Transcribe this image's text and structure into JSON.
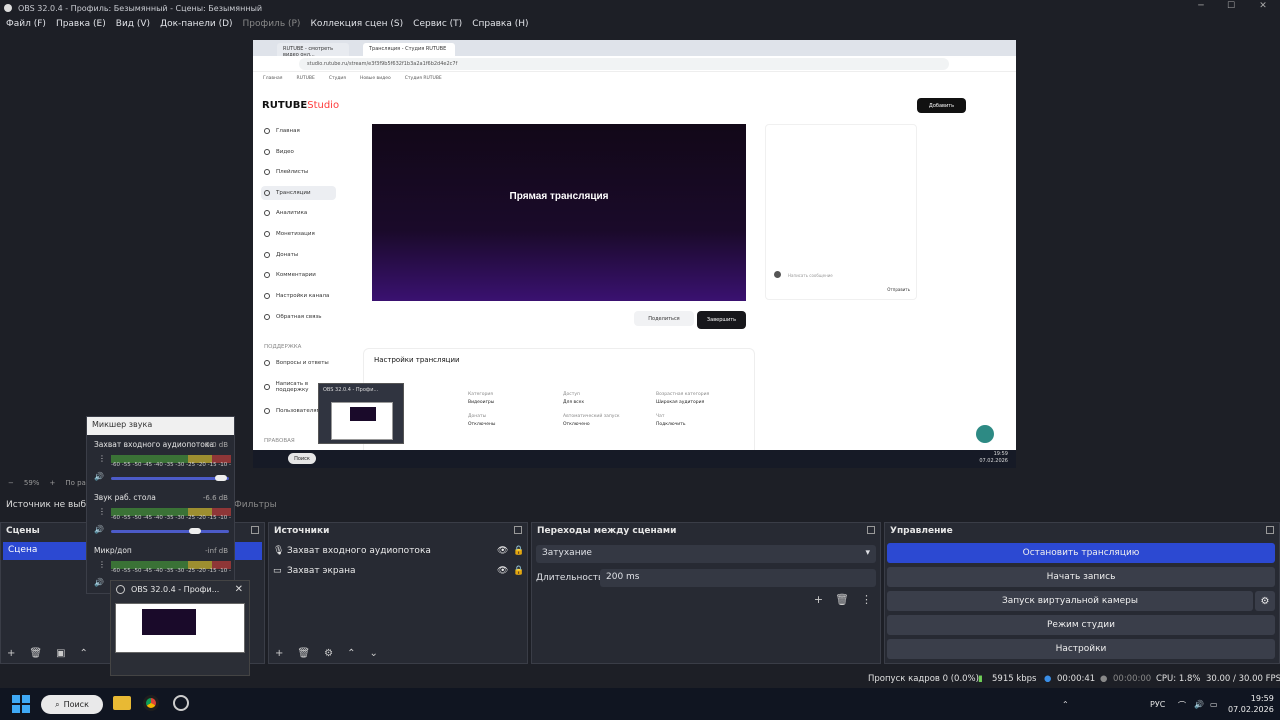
{
  "window": {
    "title": "OBS 32.0.4 - Профиль: Безымянный - Сцены: Безымянный"
  },
  "menu": [
    "Файл (F)",
    "Правка (E)",
    "Вид (V)",
    "Док-панели (D)",
    "Профиль (P)",
    "Коллекция сцен (S)",
    "Сервис (T)",
    "Справка (H)"
  ],
  "preview": {
    "tabs": [
      "RUTUBE - смотреть видео онл...",
      "Трансляция - Студия RUTUBE"
    ],
    "address": "studio.rutube.ru/stream/e3f3f9b5f632f1b3a2a1f6b2d4e2c7f",
    "bookmarks": [
      "Главная",
      "RUTUBE",
      "Студия",
      "Новые видео",
      "Студия RUTUBE"
    ],
    "logo_main": "RUTUBE",
    "logo_sub": "Studio",
    "add_button": "Добавить",
    "sidebar": [
      "Главная",
      "Видео",
      "Плейлисты",
      "Трансляции",
      "Аналитика",
      "Монетизация",
      "Донаты",
      "Комментарии",
      "Настройки канала",
      "Обратная связь"
    ],
    "support_header": "ПОДДЕРЖКА",
    "support_items": [
      "Вопросы и ответы",
      "Написать в поддержку",
      "Пользователям"
    ],
    "section_footer": "ПРАВОВАЯ",
    "player_text": "Прямая трансляция",
    "share_button": "Поделиться",
    "finish_button": "Завершить",
    "chat_placeholder": "Написать сообщение",
    "chat_send": "Отправить",
    "settings_title": "Настройки трансляции",
    "settings_fields": [
      {
        "label": "Категория",
        "value": "Видеоигры"
      },
      {
        "label": "Доступ",
        "value": "Для всех"
      },
      {
        "label": "Возрастная категория",
        "value": "Широкая аудитория"
      },
      {
        "label": "Донаты",
        "value": "Отключены"
      },
      {
        "label": "Автоматический запуск",
        "value": "Отключено"
      },
      {
        "label": "Чат",
        "value": "Подключить"
      }
    ],
    "taskbar_search": "Поиск",
    "taskbar_time": "19:59",
    "taskbar_date": "07.02.2026"
  },
  "mixer": {
    "title": "Микшер звука",
    "channels": [
      {
        "name": "Захват входного аудиопотока",
        "db": "0.0 dB",
        "level": 0.98
      },
      {
        "name": "Звук раб. стола",
        "db": "-6.6 dB",
        "level": 0.74
      },
      {
        "name": "Микр/доп",
        "db": "-inf dB",
        "level": 0.0
      }
    ],
    "ticks": "-60 -55 -50 -45 -40 -35 -30 -25 -20 -15 -10 -5 0"
  },
  "thumbnail_small_title": "OBS 32.0.4 - Профи...",
  "thumbnail_popup": {
    "title": "OBS 32.0.4 - Профи..."
  },
  "zoom": {
    "value": "59%",
    "label": "По раз"
  },
  "source_status": "Источник не выбр",
  "filters_tab": "Фильтры",
  "scenes": {
    "title": "Сцены",
    "items": [
      "Сцена"
    ]
  },
  "sources": {
    "title": "Источники",
    "items": [
      {
        "name": "Захват входного аудиопотока",
        "type": "audio"
      },
      {
        "name": "Захват экрана",
        "type": "display"
      }
    ]
  },
  "transitions": {
    "title": "Переходы между сценами",
    "selected": "Затухание",
    "duration_label": "Длительность",
    "duration_value": "200 ms"
  },
  "controls": {
    "title": "Управление",
    "buttons": [
      "Остановить трансляцию",
      "Начать запись",
      "Запуск виртуальной камеры",
      "Режим студии",
      "Настройки"
    ]
  },
  "status": {
    "dropped": "Пропуск кадров 0 (0.0%)",
    "bitrate": "5915 kbps",
    "stream_time": "00:00:41",
    "rec_time": "00:00:00",
    "cpu": "CPU: 1.8%",
    "fps": "30.00 / 30.00 FPS"
  },
  "taskbar": {
    "search": "Поиск",
    "lang": "РУС",
    "time": "19:59",
    "date": "07.02.2026"
  },
  "colors": {
    "accent": "#2c49d2",
    "dock_bg": "#272a33",
    "window_bg": "#1d1f26"
  }
}
